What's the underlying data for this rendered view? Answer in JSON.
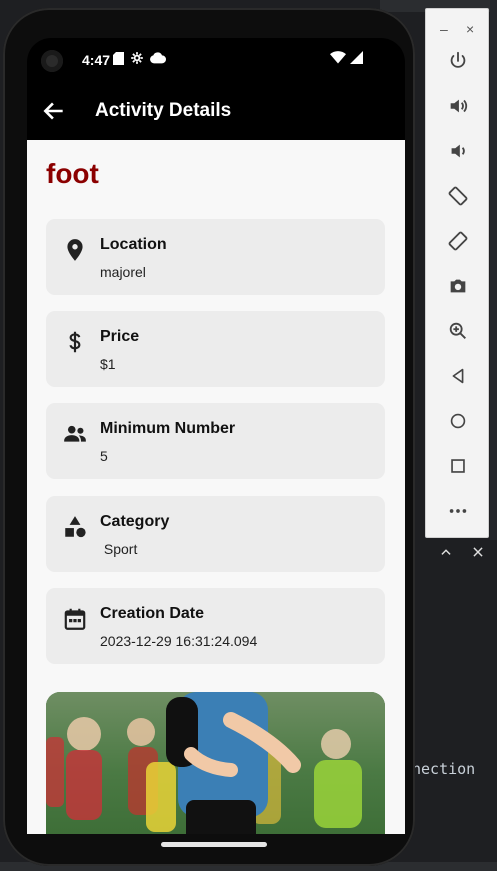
{
  "status_bar": {
    "time": "4:47"
  },
  "app_bar": {
    "title": "Activity Details"
  },
  "activity": {
    "name": "foot",
    "fields": [
      {
        "label": "Location",
        "value": "majorel",
        "icon": "location-pin-icon"
      },
      {
        "label": "Price",
        "value": "$1",
        "icon": "dollar-icon"
      },
      {
        "label": "Minimum Number",
        "value": "5",
        "icon": "group-icon"
      },
      {
        "label": "Category",
        "value": " Sport",
        "icon": "category-shapes-icon"
      },
      {
        "label": "Creation Date",
        "value": "2023-12-29 16:31:24.094",
        "icon": "calendar-icon"
      }
    ]
  },
  "emulator_toolbar": {
    "minimize": "–",
    "close": "×",
    "buttons": [
      "power-icon",
      "volume-up-icon",
      "volume-down-icon",
      "rotate-left-icon",
      "rotate-right-icon",
      "camera-icon",
      "zoom-icon",
      "back-icon",
      "home-icon",
      "overview-icon",
      "more-icon"
    ]
  },
  "ide": {
    "code_fragment": "nection"
  },
  "colors": {
    "title": "#8b0000",
    "card_bg": "#ececec",
    "appbar_bg": "#000000"
  }
}
